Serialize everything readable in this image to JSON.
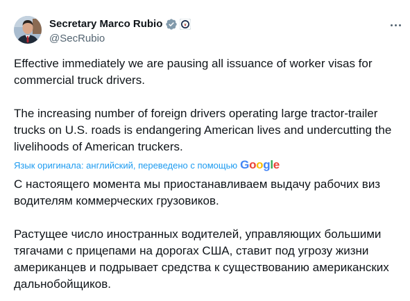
{
  "author": {
    "display_name": "Secretary Marco Rubio",
    "handle": "@SecRubio",
    "verified_badge_icon": "verified-badge-icon",
    "affiliation_icon": "government-seal-icon"
  },
  "menu": {
    "icon": "more-horizontal-icon"
  },
  "tweet": {
    "paragraphs": [
      "Effective immediately we are pausing all issuance of worker visas for\ncommercial truck drivers.",
      "The increasing number of foreign drivers operating large tractor-trailer\ntrucks on U.S. roads is endangering American lives and undercutting the\nlivelihoods of American truckers."
    ]
  },
  "translation": {
    "note": "Язык оригинала: английский, переведено с помощью",
    "provider_logo_text": "Google",
    "paragraphs": [
      "С настоящего момента мы приостанавливаем выдачу рабочих виз\nводителям коммерческих грузовиков.",
      "Растущее число иностранных водителей, управляющих большими\nтягачами с прицепами на дорогах США, ставит под угрозу жизни\nамериканцев и подрывает средства к существованию американских\nдальнобойщиков."
    ]
  },
  "colors": {
    "text_primary": "#0f1419",
    "text_secondary": "#536471",
    "link_blue": "#1d9bf0",
    "verified_blue": "#1d9bf0"
  }
}
